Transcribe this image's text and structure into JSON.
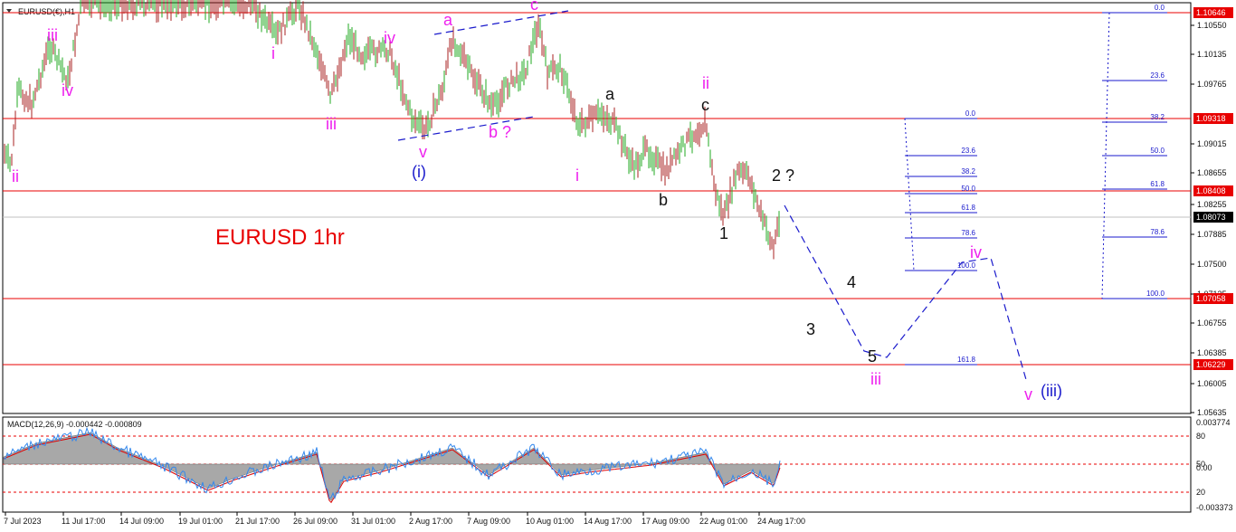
{
  "symbol_header": "EURUSD(€),H1",
  "chart_title": "EURUSD 1hr",
  "colors": {
    "red": "#e80000",
    "magenta": "#ee22ee",
    "blue": "#1a1acc",
    "dark": "#111111",
    "bull": "#22aa22",
    "bear": "#aa2222",
    "fib": "#1a1acc",
    "macd_fill": "#a8a8a8",
    "macd_signal": "#dd0000",
    "macd_line": "#3388ee",
    "grid_gray": "#c0c0c0"
  },
  "price_axis": {
    "labels": [
      "1.10550",
      "1.10135",
      "1.09765",
      "1.09015",
      "1.08655",
      "1.08255",
      "1.07885",
      "1.07500",
      "1.07135",
      "1.06755",
      "1.06385",
      "1.06005",
      "1.05635"
    ],
    "tags": [
      {
        "name": "tag-106646",
        "text": "1.10646",
        "style": "red"
      },
      {
        "name": "tag-109318",
        "text": "1.09318",
        "style": "red"
      },
      {
        "name": "tag-108408",
        "text": "1.08408",
        "style": "red"
      },
      {
        "name": "tag-108073",
        "text": "1.08073",
        "style": "black"
      },
      {
        "name": "tag-107058",
        "text": "1.07058",
        "style": "red"
      },
      {
        "name": "tag-106229",
        "text": "1.06229",
        "style": "red"
      }
    ]
  },
  "time_axis": {
    "labels": [
      "7 Jul 2023",
      "11 Jul 17:00",
      "14 Jul 09:00",
      "19 Jul 01:00",
      "21 Jul 17:00",
      "26 Jul 09:00",
      "31 Jul 01:00",
      "2 Aug 17:00",
      "7 Aug 09:00",
      "10 Aug 01:00",
      "14 Aug 17:00",
      "17 Aug 09:00",
      "22 Aug 01:00",
      "24 Aug 17:00"
    ]
  },
  "wave_labels": [
    {
      "name": "wave-ii-left",
      "text": "ii",
      "color": "magenta"
    },
    {
      "name": "wave-iii-left",
      "text": "iii",
      "color": "magenta"
    },
    {
      "name": "wave-iv-left",
      "text": "iv",
      "color": "magenta"
    },
    {
      "name": "wave-i-top",
      "text": "i",
      "color": "magenta"
    },
    {
      "name": "wave-iii-mid",
      "text": "iii",
      "color": "magenta"
    },
    {
      "name": "wave-iv-mid",
      "text": "iv",
      "color": "magenta"
    },
    {
      "name": "wave-v-mid",
      "text": "v",
      "color": "magenta"
    },
    {
      "name": "wave-i-blue",
      "text": "(i)",
      "color": "blue"
    },
    {
      "name": "wave-a-magenta",
      "text": "a",
      "color": "magenta"
    },
    {
      "name": "wave-c-magenta",
      "text": "c",
      "color": "magenta"
    },
    {
      "name": "wave-b-question",
      "text": "b ?",
      "color": "magenta"
    },
    {
      "name": "wave-i-lower",
      "text": "i",
      "color": "magenta"
    },
    {
      "name": "wave-a-black",
      "text": "a",
      "color": "dark"
    },
    {
      "name": "wave-b-black",
      "text": "b",
      "color": "dark"
    },
    {
      "name": "wave-c-black",
      "text": "c",
      "color": "dark"
    },
    {
      "name": "wave-ii-magenta",
      "text": "ii",
      "color": "magenta"
    },
    {
      "name": "wave-1",
      "text": "1",
      "color": "dark"
    },
    {
      "name": "wave-2-question",
      "text": "2 ?",
      "color": "dark"
    },
    {
      "name": "wave-3",
      "text": "3",
      "color": "dark"
    },
    {
      "name": "wave-4",
      "text": "4",
      "color": "dark"
    },
    {
      "name": "wave-5",
      "text": "5",
      "color": "dark"
    },
    {
      "name": "wave-iii-projected",
      "text": "iii",
      "color": "magenta"
    },
    {
      "name": "wave-iv-projected",
      "text": "iv",
      "color": "magenta"
    },
    {
      "name": "wave-v-projected",
      "text": "v",
      "color": "magenta"
    },
    {
      "name": "wave-iii-blue",
      "text": "(iii)",
      "color": "blue"
    }
  ],
  "fib_left": [
    {
      "text": "0.0"
    },
    {
      "text": "23.6"
    },
    {
      "text": "38.2"
    },
    {
      "text": "50.0"
    },
    {
      "text": "61.8"
    },
    {
      "text": "78.6"
    },
    {
      "text": "100.0"
    },
    {
      "text": "161.8"
    }
  ],
  "fib_right": [
    {
      "text": "0.0"
    },
    {
      "text": "23.6"
    },
    {
      "text": "38.2"
    },
    {
      "text": "50.0"
    },
    {
      "text": "61.8"
    },
    {
      "text": "78.6"
    },
    {
      "text": "100.0"
    }
  ],
  "macd": {
    "header": "MACD(12,26,9) -0.000442 -0.000809",
    "axis_labels": [
      "0.003774",
      "80",
      "50",
      "0.00",
      "20",
      "-0.003373"
    ]
  }
}
